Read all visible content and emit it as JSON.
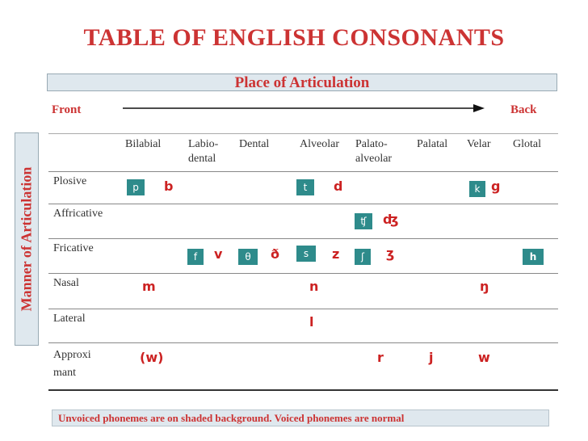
{
  "title": "TABLE OF ENGLISH CONSONANTS",
  "place_label": "Place of Articulation",
  "front_label": "Front",
  "back_label": "Back",
  "manner_label": "Manner of Articulation",
  "headers": {
    "bilabial": "Bilabial",
    "labio_line1": "Labio-",
    "labio_line2": "dental",
    "dental": "Dental",
    "alveolar": "Alveolar",
    "palato_line1": "Palato-",
    "palato_line2": "alveolar",
    "palatal": "Palatal",
    "velar": "Velar",
    "glotal": "Glotal"
  },
  "rows": {
    "plosive": "Plosive",
    "affricative": "Affricative",
    "fricative": "Fricative",
    "nasal": "Nasal",
    "lateral": "Lateral",
    "approx_line1": "Approxi",
    "approx_line2": "mant"
  },
  "phonemes": {
    "p": "p",
    "b": "b",
    "t": "t",
    "d": "d",
    "k": "k",
    "g": "g",
    "tsh": "ʧ",
    "dzh": "ʤ",
    "f": "f",
    "v": "v",
    "theta": "θ",
    "eth": "ð",
    "s": "s",
    "z": "z",
    "esh": "ʃ",
    "ezh": "ʒ",
    "h": "h",
    "m": "m",
    "n": "n",
    "ng": "ŋ",
    "l": "l",
    "w_paren": "(w)",
    "r": "r",
    "j": "j",
    "w": "w"
  },
  "footer": "Unvoiced phonemes are on shaded background. Voiced phonemes are normal",
  "colors": {
    "accent_red": "#cc3333",
    "unvoiced_bg": "#2e8b8b",
    "band_bg": "#dfe8ee"
  }
}
